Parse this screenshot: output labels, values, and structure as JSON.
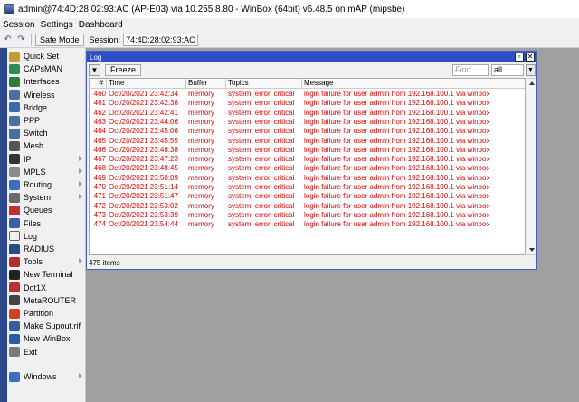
{
  "window_title": "admin@74:4D:28:02:93:AC (AP-E03) via 10.255.8.80 - WinBox (64bit) v6.48.5 on mAP (mipsbe)",
  "menu": [
    "Session",
    "Settings",
    "Dashboard"
  ],
  "toolbar": {
    "undo_icon": "undo-icon",
    "redo_icon": "redo-icon",
    "safe_mode_label": "Safe Mode",
    "session_label": "Session:",
    "session_value": "74:4D:28:02:93:AC"
  },
  "sidebar": {
    "items": [
      {
        "label": "Quick Set",
        "icon": "quick-set-icon",
        "color": "#c89a30",
        "submenu": false
      },
      {
        "label": "CAPsMAN",
        "icon": "capsman-icon",
        "color": "#2e8b57",
        "submenu": false
      },
      {
        "label": "Interfaces",
        "icon": "interfaces-icon",
        "color": "#2e7d32",
        "submenu": false
      },
      {
        "label": "Wireless",
        "icon": "wireless-icon",
        "color": "#4a6fa5",
        "submenu": false
      },
      {
        "label": "Bridge",
        "icon": "bridge-icon",
        "color": "#3b6ab0",
        "submenu": false
      },
      {
        "label": "PPP",
        "icon": "ppp-icon",
        "color": "#4a6fa5",
        "submenu": false
      },
      {
        "label": "Switch",
        "icon": "switch-icon",
        "color": "#4a6fa5",
        "submenu": false
      },
      {
        "label": "Mesh",
        "icon": "mesh-icon",
        "color": "#555555",
        "submenu": false
      },
      {
        "label": "IP",
        "icon": "ip-icon",
        "color": "#333333",
        "submenu": true
      },
      {
        "label": "MPLS",
        "icon": "mpls-icon",
        "color": "#8a8a8a",
        "submenu": true
      },
      {
        "label": "Routing",
        "icon": "routing-icon",
        "color": "#3a6fc0",
        "submenu": true
      },
      {
        "label": "System",
        "icon": "system-icon",
        "color": "#6a6a6a",
        "submenu": true
      },
      {
        "label": "Queues",
        "icon": "queues-icon",
        "color": "#c03030",
        "submenu": false
      },
      {
        "label": "Files",
        "icon": "files-icon",
        "color": "#3a5fa8",
        "submenu": false
      },
      {
        "label": "Log",
        "icon": "log-icon",
        "color": "#f0f0f0",
        "submenu": false
      },
      {
        "label": "RADIUS",
        "icon": "radius-icon",
        "color": "#2a4a8a",
        "submenu": false
      },
      {
        "label": "Tools",
        "icon": "tools-icon",
        "color": "#b03030",
        "submenu": true
      },
      {
        "label": "New Terminal",
        "icon": "terminal-icon",
        "color": "#222222",
        "submenu": false
      },
      {
        "label": "Dot1X",
        "icon": "dot1x-icon",
        "color": "#c03030",
        "submenu": false
      },
      {
        "label": "MetaROUTER",
        "icon": "metarouter-icon",
        "color": "#444444",
        "submenu": false
      },
      {
        "label": "Partition",
        "icon": "partition-icon",
        "color": "#d04020",
        "submenu": false
      },
      {
        "label": "Make Supout.rif",
        "icon": "supout-icon",
        "color": "#3060a0",
        "submenu": false
      },
      {
        "label": "New WinBox",
        "icon": "winbox-icon",
        "color": "#2a5aa8",
        "submenu": false
      },
      {
        "label": "Exit",
        "icon": "exit-icon",
        "color": "#7a7a7a",
        "submenu": false
      }
    ],
    "windows_label": "Windows",
    "windows_icon": "windows-icon"
  },
  "log_window": {
    "title": "Log",
    "freeze_label": "Freeze",
    "filter_icon": "filter-icon",
    "find_placeholder": "Find",
    "find_value": "",
    "filter_select": "all",
    "columns": [
      "#",
      "Time",
      "Buffer",
      "Topics",
      "Message"
    ],
    "rows": [
      {
        "num": "460",
        "time": "Oct/20/2021 23:42:34",
        "buffer": "memory",
        "topics": "system, error, critical",
        "message": "login failure for user admin from 192.168.100.1 via winbox"
      },
      {
        "num": "461",
        "time": "Oct/20/2021 23:42:38",
        "buffer": "memory",
        "topics": "system, error, critical",
        "message": "login failure for user admin from 192.168.100.1 via winbox"
      },
      {
        "num": "462",
        "time": "Oct/20/2021 23:42:41",
        "buffer": "memory",
        "topics": "system, error, critical",
        "message": "login failure for user admin from 192.168.100.1 via winbox"
      },
      {
        "num": "463",
        "time": "Oct/20/2021 23:44:06",
        "buffer": "memory",
        "topics": "system, error, critical",
        "message": "login failure for user admin from 192.168.100.1 via winbox"
      },
      {
        "num": "464",
        "time": "Oct/20/2021 23:45:06",
        "buffer": "memory",
        "topics": "system, error, critical",
        "message": "login failure for user admin from 192.168.100.1 via winbox"
      },
      {
        "num": "465",
        "time": "Oct/20/2021 23:45:55",
        "buffer": "memory",
        "topics": "system, error, critical",
        "message": "login failure for user admin from 192.168.100.1 via winbox"
      },
      {
        "num": "466",
        "time": "Oct/20/2021 23:46:38",
        "buffer": "memory",
        "topics": "system, error, critical",
        "message": "login failure for user admin from 192.168.100.1 via winbox"
      },
      {
        "num": "467",
        "time": "Oct/20/2021 23:47:23",
        "buffer": "memory",
        "topics": "system, error, critical",
        "message": "login failure for user admin from 192.168.100.1 via winbox"
      },
      {
        "num": "468",
        "time": "Oct/20/2021 23:48:45",
        "buffer": "memory",
        "topics": "system, error, critical",
        "message": "login failure for user admin from 192.168.100.1 via winbox"
      },
      {
        "num": "469",
        "time": "Oct/20/2021 23:50:09",
        "buffer": "memory",
        "topics": "system, error, critical",
        "message": "login failure for user admin from 192.168.100.1 via winbox"
      },
      {
        "num": "470",
        "time": "Oct/20/2021 23:51:14",
        "buffer": "memory",
        "topics": "system, error, critical",
        "message": "login failure for user admin from 192.168.100.1 via winbox"
      },
      {
        "num": "471",
        "time": "Oct/20/2021 23:51:47",
        "buffer": "memory",
        "topics": "system, error, critical",
        "message": "login failure for user admin from 192.168.100.1 via winbox"
      },
      {
        "num": "472",
        "time": "Oct/20/2021 23:53:02",
        "buffer": "memory",
        "topics": "system, error, critical",
        "message": "login failure for user admin from 192.168.100.1 via winbox"
      },
      {
        "num": "473",
        "time": "Oct/20/2021 23:53:39",
        "buffer": "memory",
        "topics": "system, error, critical",
        "message": "login failure for user admin from 192.168.100.1 via winbox"
      },
      {
        "num": "474",
        "time": "Oct/20/2021 23:54:44",
        "buffer": "memory",
        "topics": "system, error, critical",
        "message": "login failure for user admin from 192.168.100.1 via winbox"
      }
    ],
    "status": "475 items"
  },
  "colors": {
    "sidebar_strip": "#2e4a8c",
    "log_title_bar": "#2d50c8",
    "error_text": "#e00000",
    "workspace": "#a0a0a0"
  }
}
